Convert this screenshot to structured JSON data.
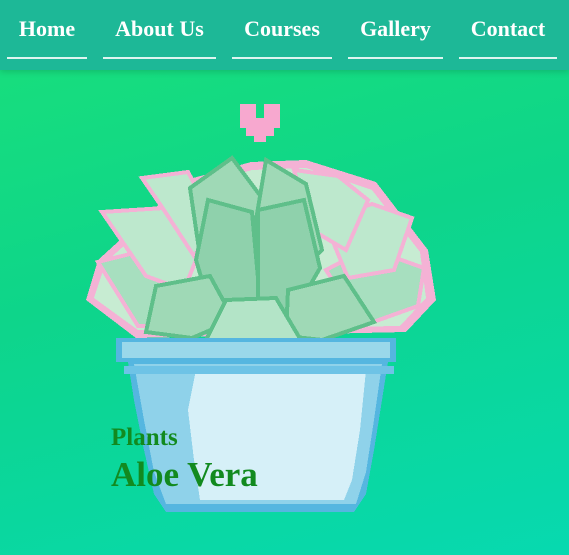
{
  "nav": {
    "items": [
      {
        "label": "Home"
      },
      {
        "label": "About Us"
      },
      {
        "label": "Courses"
      },
      {
        "label": "Gallery"
      },
      {
        "label": "Contact"
      }
    ]
  },
  "hero": {
    "image_icon": "pixel-succulent-pot",
    "heart_icon": "heart-icon",
    "category": "Plants",
    "title": "Aloe Vera"
  },
  "colors": {
    "nav_bg": "#1db897",
    "background_start": "#1ae07a",
    "background_end": "#07d9b0",
    "caption_text": "#128a1f",
    "heart": "#f7a8cf",
    "pot": "#9ad8ea",
    "soil": "#a8643a",
    "leaves": "#9cdcb8"
  }
}
